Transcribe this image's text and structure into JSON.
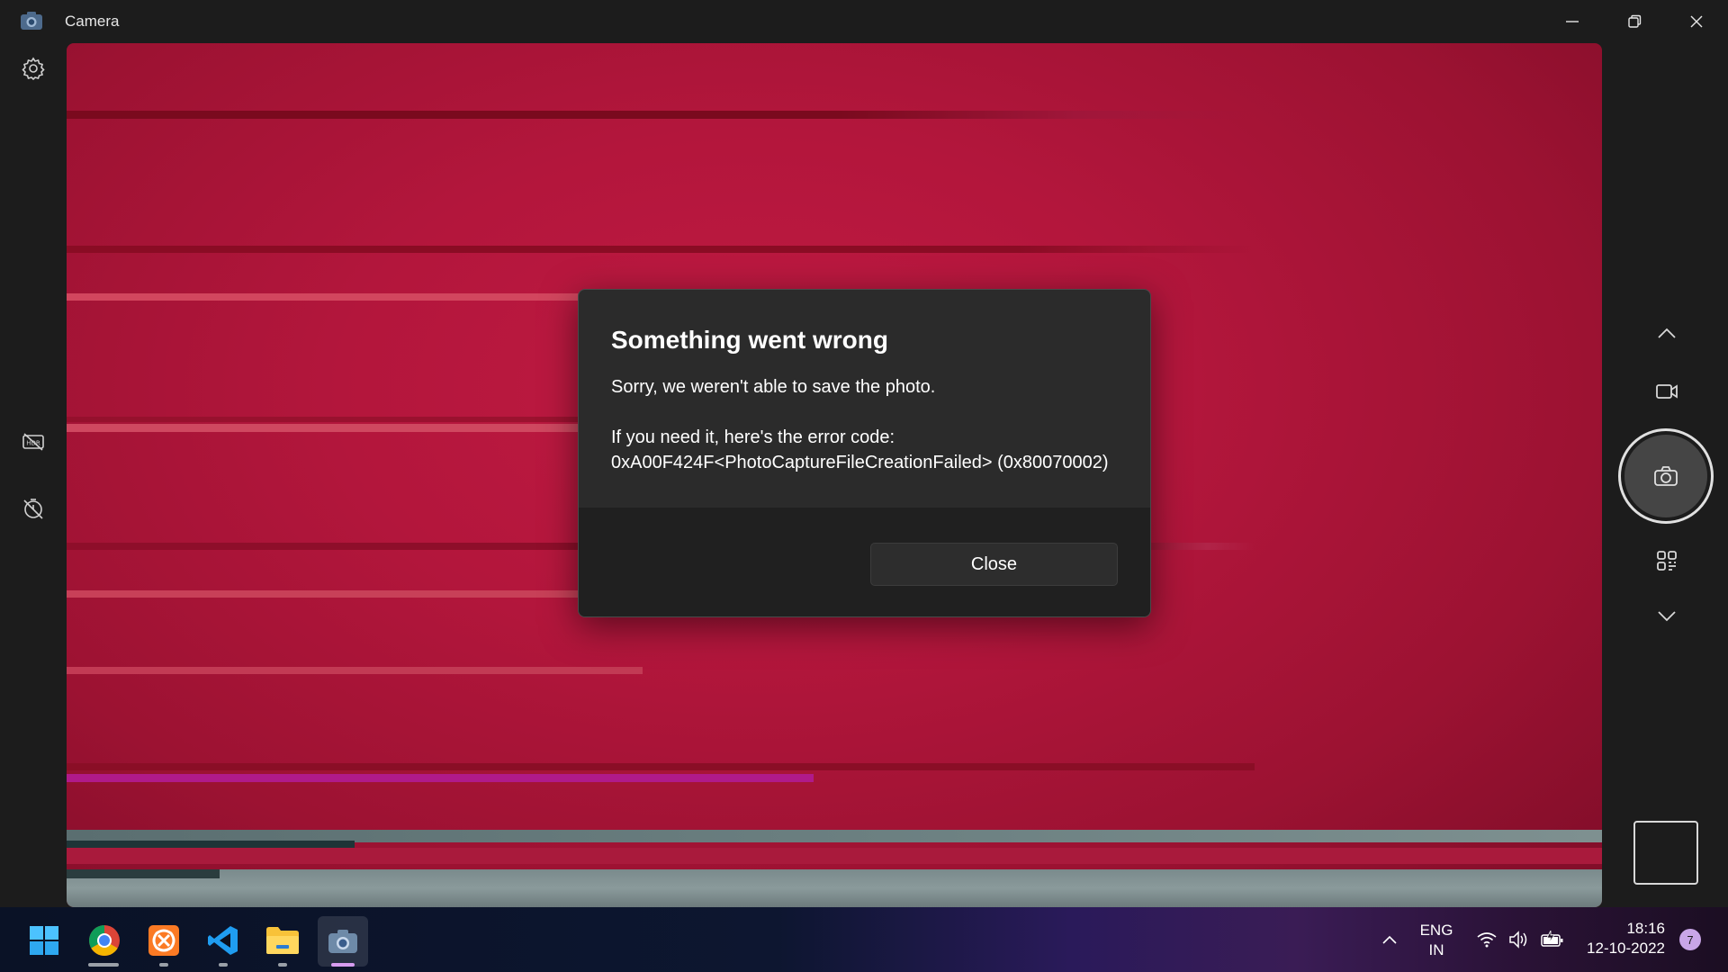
{
  "window": {
    "title": "Camera",
    "icon": "camera-app-icon",
    "controls": [
      "minimize-icon",
      "restore-icon",
      "close-icon"
    ]
  },
  "left_rail": {
    "items": [
      {
        "name": "settings",
        "icon": "gear-icon"
      },
      {
        "name": "hdr-off",
        "icon": "hdr-off-icon"
      },
      {
        "name": "timer-off",
        "icon": "timer-off-icon"
      }
    ]
  },
  "dialog": {
    "title": "Something went wrong",
    "message": "Sorry, we weren't able to save the photo.",
    "error_intro": "If you need it, here's the error code:",
    "error_code": "0xA00F424F<PhotoCaptureFileCreationFailed> (0x80070002)",
    "close_label": "Close"
  },
  "right_rail": {
    "items": [
      {
        "name": "scroll-up",
        "icon": "chevron-up-icon"
      },
      {
        "name": "video-mode",
        "icon": "video-camera-icon"
      },
      {
        "name": "shutter",
        "icon": "camera-icon"
      },
      {
        "name": "qr-scan",
        "icon": "qr-code-icon"
      },
      {
        "name": "scroll-down",
        "icon": "chevron-down-icon"
      }
    ]
  },
  "taskbar": {
    "apps": [
      {
        "name": "start",
        "icon": "windows-logo-icon"
      },
      {
        "name": "chrome",
        "icon": "chrome-icon"
      },
      {
        "name": "xampp",
        "icon": "xampp-icon"
      },
      {
        "name": "vscode",
        "icon": "vscode-icon"
      },
      {
        "name": "file-explorer",
        "icon": "folder-icon"
      },
      {
        "name": "camera",
        "icon": "camera-app-icon",
        "active": true
      }
    ],
    "tray": {
      "language_line1": "ENG",
      "language_line2": "IN",
      "time": "18:16",
      "date": "12-10-2022",
      "notification_count": "7"
    }
  },
  "colors": {
    "viewfinder_red": "#b3163c",
    "dialog_bg": "#2b2b2b",
    "dialog_footer": "#202020",
    "accent_badge": "#c9a6e8"
  }
}
